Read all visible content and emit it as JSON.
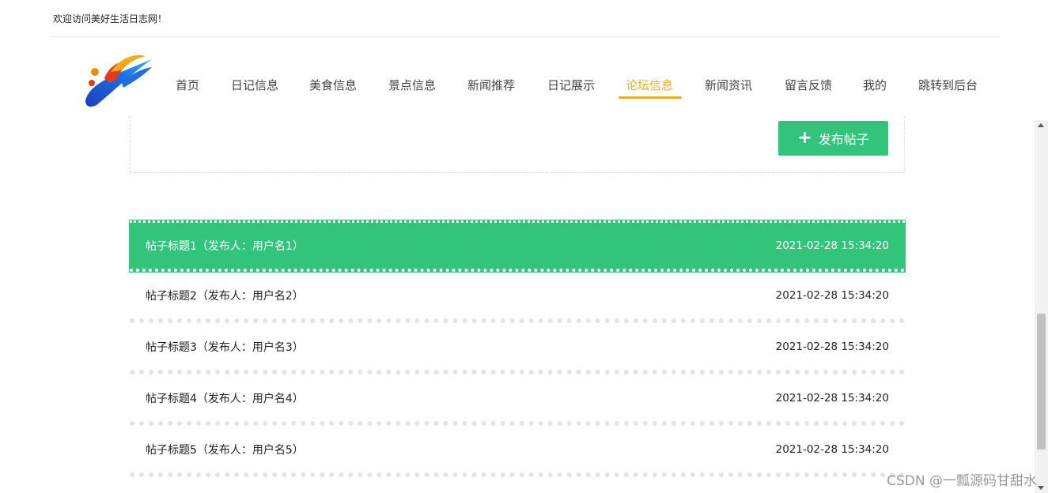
{
  "topbar": {
    "welcome": "欢迎访问美好生活日志网！"
  },
  "nav": {
    "items": [
      {
        "label": "首页",
        "active": false
      },
      {
        "label": "日记信息",
        "active": false
      },
      {
        "label": "美食信息",
        "active": false
      },
      {
        "label": "景点信息",
        "active": false
      },
      {
        "label": "新闻推荐",
        "active": false
      },
      {
        "label": "日记展示",
        "active": false
      },
      {
        "label": "论坛信息",
        "active": true
      },
      {
        "label": "新闻资讯",
        "active": false
      },
      {
        "label": "留言反馈",
        "active": false
      },
      {
        "label": "我的",
        "active": false
      },
      {
        "label": "跳转到后台",
        "active": false
      }
    ],
    "accent_color": "#e8b01b"
  },
  "publish": {
    "label": "发布帖子",
    "icon": "plus-icon",
    "color": "#33c47b"
  },
  "posts": [
    {
      "title": "帖子标题1（发布人：用户名1）",
      "time": "2021-02-28 15:34:20",
      "active": true
    },
    {
      "title": "帖子标题2（发布人：用户名2）",
      "time": "2021-02-28 15:34:20",
      "active": false
    },
    {
      "title": "帖子标题3（发布人：用户名3）",
      "time": "2021-02-28 15:34:20",
      "active": false
    },
    {
      "title": "帖子标题4（发布人：用户名4）",
      "time": "2021-02-28 15:34:20",
      "active": false
    },
    {
      "title": "帖子标题5（发布人：用户名5）",
      "time": "2021-02-28 15:34:20",
      "active": false
    }
  ],
  "watermark": "CSDN @一瓢源码甘甜水"
}
